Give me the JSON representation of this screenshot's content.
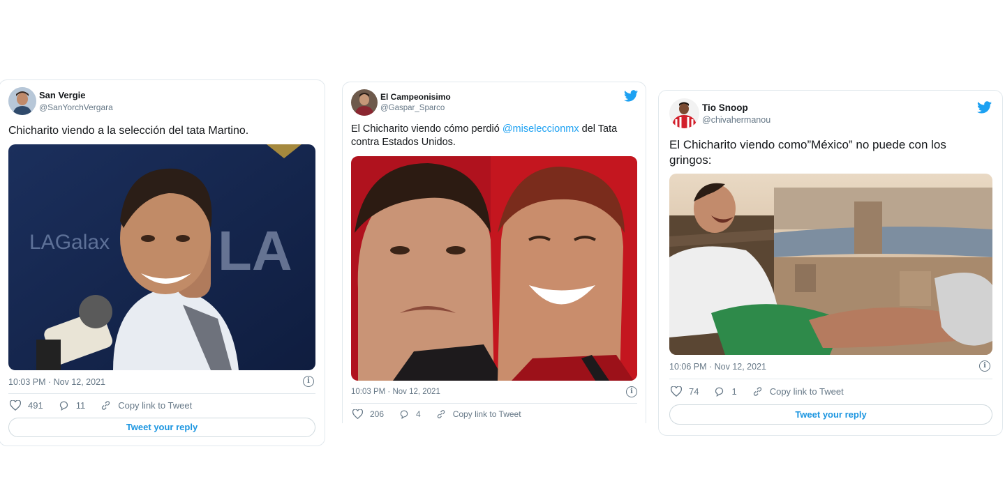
{
  "tweets": [
    {
      "name": "San Vergie",
      "handle": "@SanYorchVergara",
      "text": "Chicharito viendo a la selección del tata Martino.",
      "image_caption_text": "LAGalaxy LA",
      "timestamp": "10:03 PM · Nov 12, 2021",
      "likes": "491",
      "replies": "11",
      "copy_link": "Copy link to Tweet",
      "reply_prompt": "Tweet your reply"
    },
    {
      "name": "El Campeonisimo",
      "handle": "@Gaspar_Sparco",
      "text_before": "El Chicharito viendo cómo perdió ",
      "mention": "@miseleccionmx",
      "text_after": " del Tata contra Estados Unidos.",
      "timestamp": "10:03 PM · Nov 12, 2021",
      "likes": "206",
      "replies": "4",
      "copy_link": "Copy link to Tweet"
    },
    {
      "name": "Tio Snoop",
      "handle": "@chivahermanou",
      "text": "El Chicharito viendo como”México” no puede con los gringos:",
      "timestamp": "10:06 PM · Nov 12, 2021",
      "likes": "74",
      "replies": "1",
      "copy_link": "Copy link to Tweet",
      "reply_prompt": "Tweet your reply"
    }
  ],
  "colors": {
    "twitter_blue": "#1da1f2",
    "link_blue": "#1b95e0",
    "muted": "#657786",
    "border": "#e1e8ed"
  },
  "icons": [
    "heart-icon",
    "reply-bubble-icon",
    "link-icon",
    "info-icon",
    "twitter-bird-icon"
  ]
}
